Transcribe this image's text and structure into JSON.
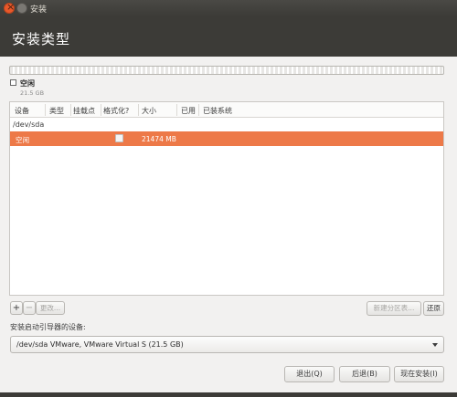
{
  "window": {
    "title": "安装"
  },
  "header": {
    "title": "安装类型"
  },
  "legend": {
    "label": "空闲",
    "size": "21.5 GB"
  },
  "table": {
    "columns": [
      "设备",
      "类型",
      "挂载点",
      "格式化?",
      "大小",
      "已用",
      "已装系统"
    ],
    "device": "/dev/sda",
    "selected_row": {
      "device": "空闲",
      "type": "",
      "mount": "",
      "format": false,
      "size": "21474 MB",
      "used": "",
      "system": ""
    }
  },
  "buttons": {
    "add": "+",
    "remove": "−",
    "change": "更改...",
    "new_table": "新建分区表...",
    "revert": "还原",
    "quit": "退出(Q)",
    "back": "后退(B)",
    "install": "现在安装(I)"
  },
  "bootloader": {
    "label": "安装启动引导器的设备:",
    "value": "/dev/sda VMware, VMware Virtual S (21.5 GB)"
  },
  "colors": {
    "selection": "#ed7948",
    "titlebar": "#3c3b37"
  }
}
